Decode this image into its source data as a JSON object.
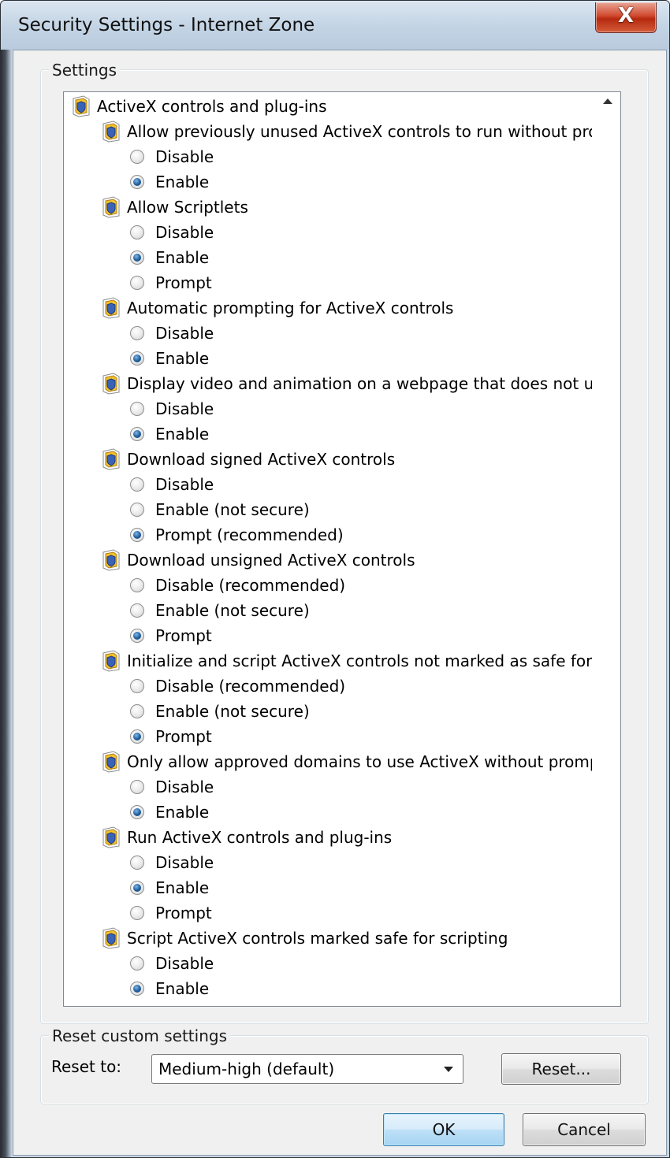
{
  "window": {
    "title": "Security Settings - Internet Zone",
    "close_symbol": "X"
  },
  "settings_group": {
    "legend": "Settings"
  },
  "tree": {
    "root": "ActiveX controls and plug-ins",
    "settings": [
      {
        "label": "Allow previously unused ActiveX controls to run without prompt",
        "options": [
          {
            "label": "Disable",
            "checked": false
          },
          {
            "label": "Enable",
            "checked": true
          }
        ]
      },
      {
        "label": "Allow Scriptlets",
        "options": [
          {
            "label": "Disable",
            "checked": false
          },
          {
            "label": "Enable",
            "checked": true
          },
          {
            "label": "Prompt",
            "checked": false
          }
        ]
      },
      {
        "label": "Automatic prompting for ActiveX controls",
        "options": [
          {
            "label": "Disable",
            "checked": false
          },
          {
            "label": "Enable",
            "checked": true
          }
        ]
      },
      {
        "label": "Display video and animation on a webpage that does not use",
        "options": [
          {
            "label": "Disable",
            "checked": false
          },
          {
            "label": "Enable",
            "checked": true
          }
        ]
      },
      {
        "label": "Download signed ActiveX controls",
        "options": [
          {
            "label": "Disable",
            "checked": false
          },
          {
            "label": "Enable (not secure)",
            "checked": false
          },
          {
            "label": "Prompt (recommended)",
            "checked": true
          }
        ]
      },
      {
        "label": "Download unsigned ActiveX controls",
        "options": [
          {
            "label": "Disable (recommended)",
            "checked": false
          },
          {
            "label": "Enable (not secure)",
            "checked": false
          },
          {
            "label": "Prompt",
            "checked": true
          }
        ]
      },
      {
        "label": "Initialize and script ActiveX controls not marked as safe for scripting",
        "options": [
          {
            "label": "Disable (recommended)",
            "checked": false
          },
          {
            "label": "Enable (not secure)",
            "checked": false
          },
          {
            "label": "Prompt",
            "checked": true
          }
        ]
      },
      {
        "label": "Only allow approved domains to use ActiveX without prompt",
        "options": [
          {
            "label": "Disable",
            "checked": false
          },
          {
            "label": "Enable",
            "checked": true
          }
        ]
      },
      {
        "label": "Run ActiveX controls and plug-ins",
        "options": [
          {
            "label": "Disable",
            "checked": false
          },
          {
            "label": "Enable",
            "checked": true
          },
          {
            "label": "Prompt",
            "checked": false
          }
        ]
      },
      {
        "label": "Script ActiveX controls marked safe for scripting",
        "options": [
          {
            "label": "Disable",
            "checked": false
          },
          {
            "label": "Enable",
            "checked": true
          }
        ]
      }
    ]
  },
  "reset_group": {
    "legend": "Reset custom settings",
    "reset_to_label": "Reset to:",
    "selected_level": "Medium-high (default)",
    "reset_button": "Reset..."
  },
  "footer": {
    "ok": "OK",
    "cancel": "Cancel"
  },
  "icons": {
    "setting": "activex-shield-icon",
    "scroll": "scroll-up-arrow-icon",
    "dropdown": "chevron-down-icon"
  }
}
